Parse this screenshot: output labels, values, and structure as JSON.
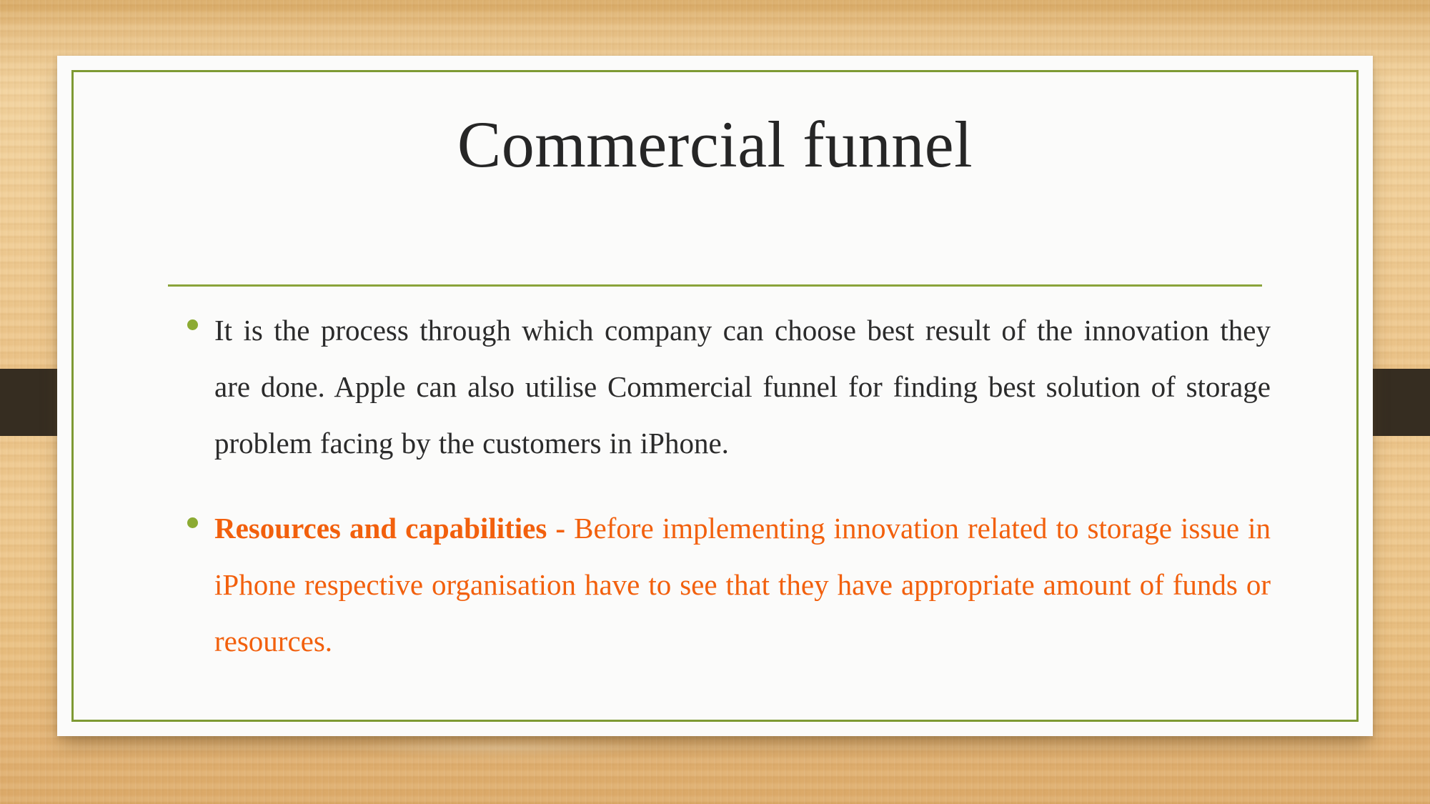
{
  "slide": {
    "title": "Commercial funnel",
    "theme": {
      "background_wood": "#eec88e",
      "card_background": "#fbfbfa",
      "inner_border": "#7e9a34",
      "rule": "#8aa43a",
      "bullet_marker": "#8cab33",
      "body_text": "#2b2b2b",
      "accent_text": "#f2600d",
      "ribbon_tab": "#362d21"
    },
    "bullets": [
      {
        "marker": "bullet-dot",
        "lead": "",
        "text": "It is the process through which company can choose best result of the innovation they are done. Apple can also utilise Commercial funnel for finding best solution of storage problem facing by the customers in iPhone.",
        "accent": false
      },
      {
        "marker": "bullet-dot",
        "lead": "Resources and capabilities - ",
        "text": "Before implementing innovation related to storage issue in iPhone respective organisation have to see that they have appropriate amount of funds or resources.",
        "accent": true
      }
    ]
  }
}
